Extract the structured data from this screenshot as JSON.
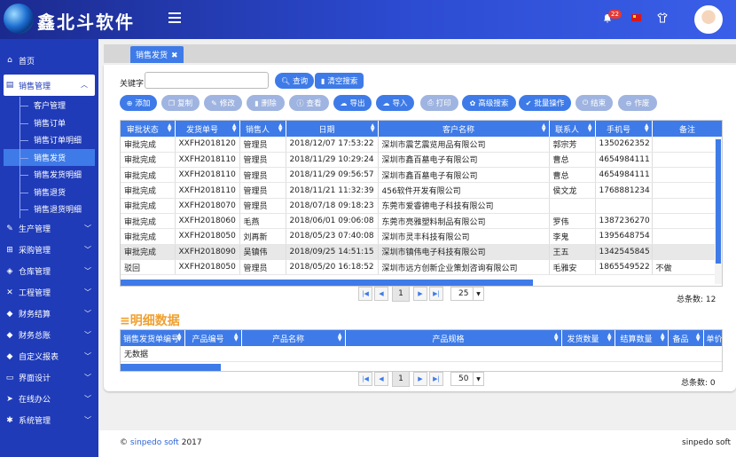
{
  "app": {
    "title": "鑫北斗软件"
  },
  "header": {
    "notif_count": "22"
  },
  "sidebar": {
    "home": "首页",
    "sales": "销售管理",
    "sales_sub": [
      "客户管理",
      "销售订单",
      "销售订单明细",
      "销售发货",
      "销售发货明细",
      "销售退货",
      "销售退货明细"
    ],
    "items": [
      "生产管理",
      "采购管理",
      "仓库管理",
      "工程管理",
      "财务结算",
      "财务总账",
      "自定义报表",
      "界面设计",
      "在线办公",
      "系统管理"
    ]
  },
  "tabs": [
    {
      "label": "销售发货"
    }
  ],
  "search": {
    "label": "关键字",
    "value": "",
    "query_btn": "查询",
    "clear_btn": "清空搜索"
  },
  "toolbar": [
    "添加",
    "复制",
    "修改",
    "删除",
    "查看",
    "导出",
    "导入",
    "打印",
    "高级搜索",
    "批量操作",
    "结束",
    "作废"
  ],
  "main_grid": {
    "columns": [
      "审批状态",
      "发货单号",
      "销售人",
      "日期",
      "客户名称",
      "联系人",
      "手机号",
      "备注"
    ],
    "rows": [
      [
        "审批完成",
        "XXFH2018120",
        "管理员",
        "2018/12/07 17:53:22",
        "深圳市震艺震览用品有限公司",
        "郭宗芳",
        "1350262352",
        ""
      ],
      [
        "审批完成",
        "XXFH2018110",
        "管理员",
        "2018/11/29 10:29:24",
        "深圳市鑫百墓电子有限公司",
        "曹总",
        "4654984111",
        ""
      ],
      [
        "审批完成",
        "XXFH2018110",
        "管理员",
        "2018/11/29 09:56:57",
        "深圳市鑫百墓电子有限公司",
        "曹总",
        "4654984111",
        ""
      ],
      [
        "审批完成",
        "XXFH2018110",
        "管理员",
        "2018/11/21 11:32:39",
        "456软件开发有限公司",
        "侯文龙",
        "1768881234",
        ""
      ],
      [
        "审批完成",
        "XXFH2018070",
        "管理员",
        "2018/07/18 09:18:23",
        "东莞市爱睿德电子科技有限公司",
        "",
        "",
        " "
      ],
      [
        "审批完成",
        "XXFH2018060",
        "毛燕",
        "2018/06/01 09:06:08",
        "东莞市亮雅塑料制品有限公司",
        "罗伟",
        "1387236270",
        ""
      ],
      [
        "审批完成",
        "XXFH2018050",
        "刘再新",
        "2018/05/23 07:40:08",
        "深圳市灵丰科技有限公司",
        "李鬼",
        "1395648754",
        ""
      ],
      [
        "审批完成",
        "XXFH2018090",
        "吴镇伟",
        "2018/09/25 14:51:15",
        "深圳市镇伟电子科技有限公司",
        "王五",
        "1342545845",
        ""
      ],
      [
        "驳回",
        "XXFH2018050",
        "管理员",
        "2018/05/20 16:18:52",
        "深圳市远方创新企业策划咨询有限公司",
        "毛雅安",
        "1865549522",
        "不做"
      ]
    ],
    "page": "1",
    "page_size": "25",
    "total": "总条数: 12"
  },
  "detail": {
    "title": "≡明细数据",
    "columns": [
      "销售发货单编号",
      "产品编号",
      "产品名称",
      "产品规格",
      "发货数量",
      "结算数量",
      "备品",
      "单价"
    ],
    "empty": "无数据",
    "page": "1",
    "page_size": "50",
    "total": "总条数: 0"
  },
  "footer": {
    "copyright": "©",
    "link": "sinpedo soft",
    "year": "2017",
    "brand": "sinpedo soft"
  },
  "colors": {
    "primary": "#3e7be8",
    "sidebar": "#1f3bb8",
    "accent": "#f0a030"
  }
}
